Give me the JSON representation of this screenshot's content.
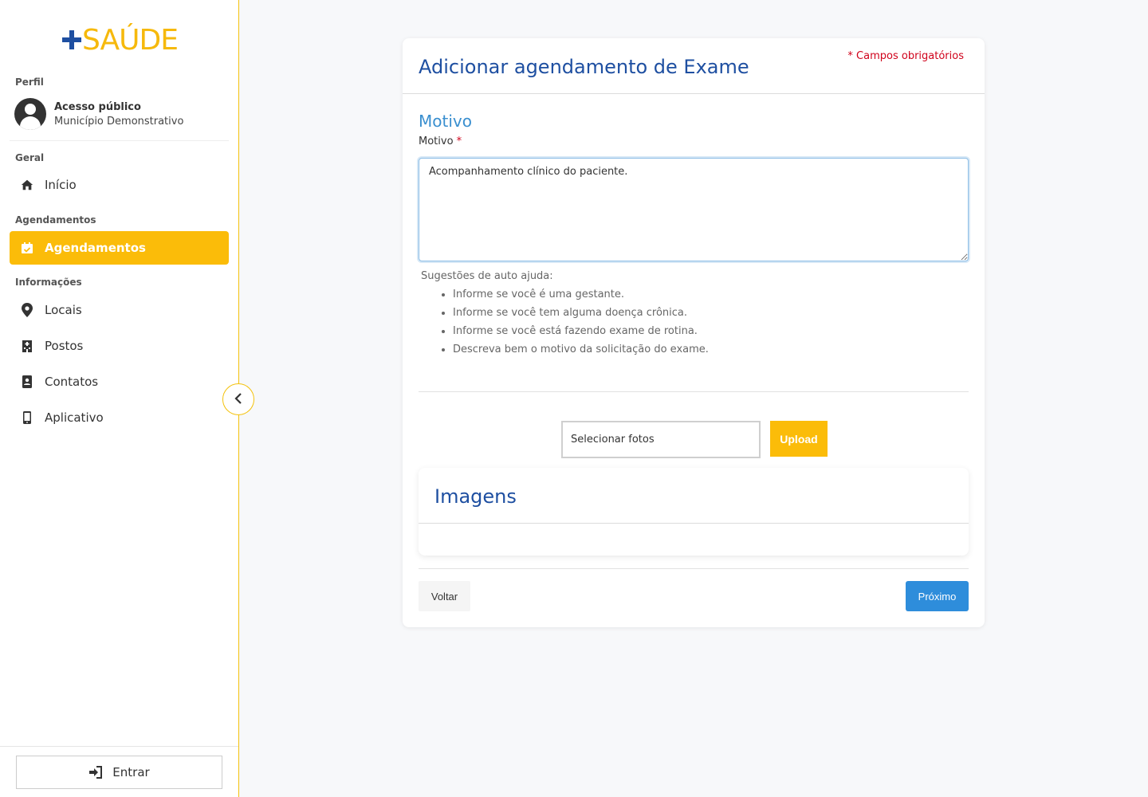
{
  "app": {
    "logo_text": "SAÚDE"
  },
  "sidebar": {
    "profile_label": "Perfil",
    "profile_name": "Acesso público",
    "profile_sub": "Município Demonstrativo",
    "sections": {
      "geral": "Geral",
      "agendamentos": "Agendamentos",
      "informacoes": "Informações"
    },
    "items": [
      {
        "label": "Início",
        "icon": "home-icon"
      },
      {
        "label": "Agendamentos",
        "icon": "calendar-check-icon",
        "active": true
      },
      {
        "label": "Locais",
        "icon": "map-pin-icon"
      },
      {
        "label": "Postos",
        "icon": "building-icon"
      },
      {
        "label": "Contatos",
        "icon": "address-book-icon"
      },
      {
        "label": "Aplicativo",
        "icon": "mobile-phone-icon"
      }
    ],
    "login_label": "Entrar",
    "accent_color": "#fbbc09"
  },
  "form": {
    "title": "Adicionar agendamento de Exame",
    "required_note": "* Campos obrigatórios",
    "section_title": "Motivo",
    "field_label": "Motivo",
    "required_mark": "*",
    "motivo_value": "Acompanhamento clínico do paciente.",
    "help_title": "Sugestões de auto ajuda:",
    "help_items": [
      "Informe se você é uma gestante.",
      "Informe se você tem alguma doença crônica.",
      "Informe se você está fazendo exame de rotina.",
      "Descreva bem o motivo da solicitação do exame."
    ],
    "file_placeholder": "Selecionar fotos",
    "upload_label": "Upload",
    "images_title": "Imagens",
    "back_label": "Voltar",
    "next_label": "Próximo",
    "title_color": "#1e4fa1",
    "primary_color": "#2e8ddb"
  }
}
